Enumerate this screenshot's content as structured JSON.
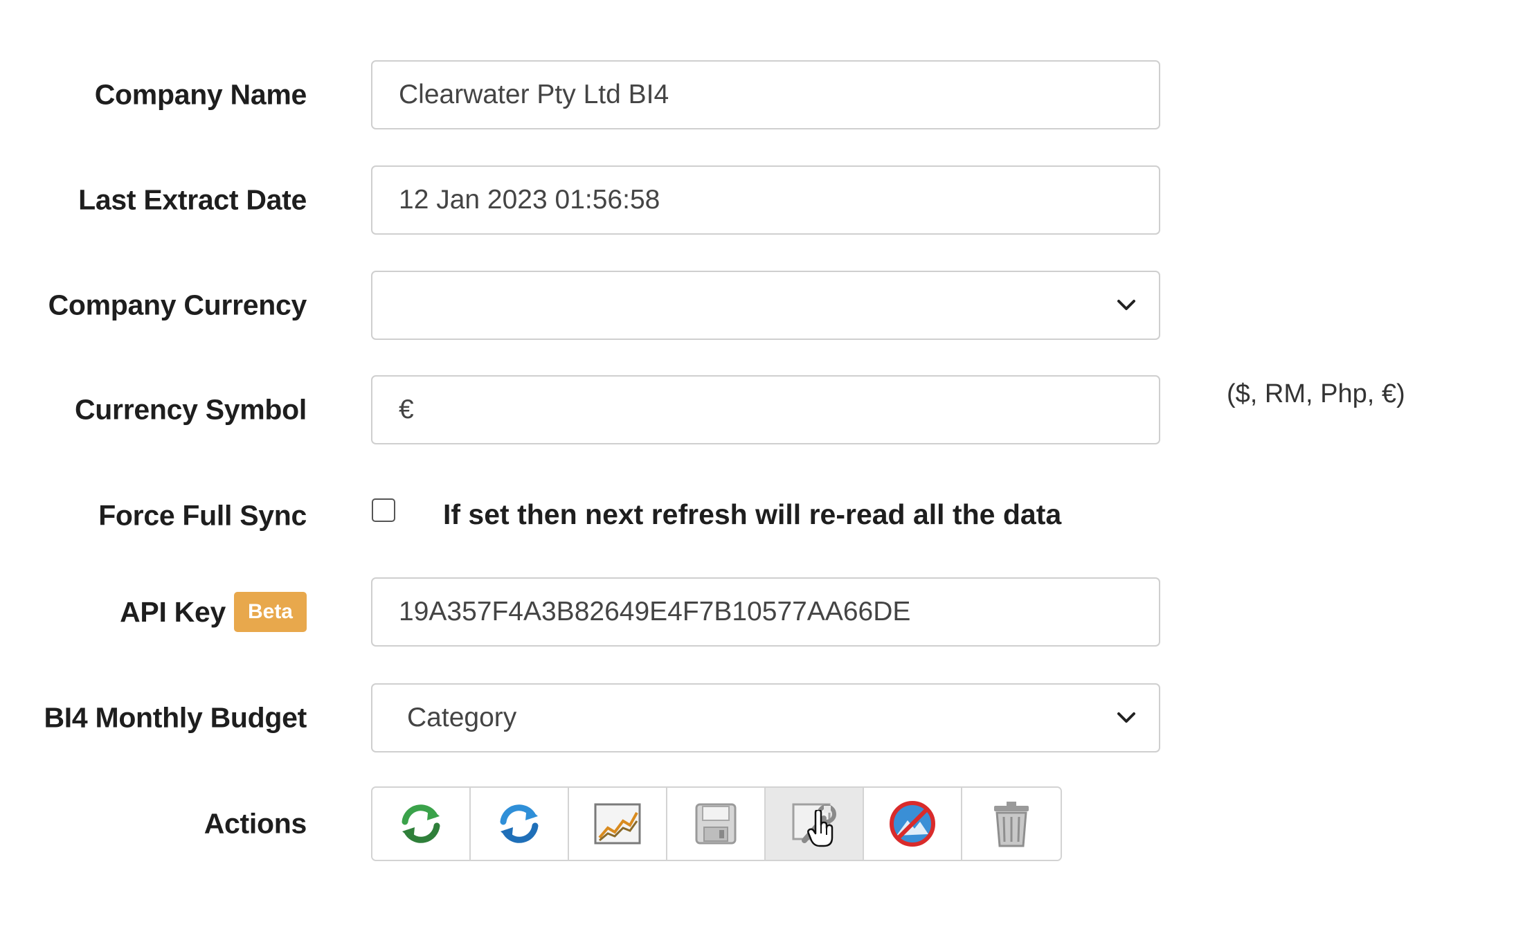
{
  "form": {
    "company_name": {
      "label": "Company Name",
      "value": "Clearwater Pty Ltd BI4"
    },
    "last_extract_date": {
      "label": "Last Extract Date",
      "value": "12 Jan 2023 01:56:58"
    },
    "company_currency": {
      "label": "Company Currency",
      "value": ""
    },
    "currency_symbol": {
      "label": "Currency Symbol",
      "value": "€",
      "hint": "($, RM, Php, €)"
    },
    "force_full_sync": {
      "label": "Force Full Sync",
      "checked": false,
      "description": "If set then next refresh will re-read all the data"
    },
    "api_key": {
      "label": "API Key",
      "badge": "Beta",
      "value": "19A357F4A3B82649E4F7B10577AA66DE"
    },
    "monthly_budget": {
      "label": "BI4 Monthly Budget",
      "value": "Category"
    },
    "actions": {
      "label": "Actions",
      "buttons": [
        {
          "icon": "refresh-green-icon"
        },
        {
          "icon": "sync-blue-icon"
        },
        {
          "icon": "chart-icon"
        },
        {
          "icon": "save-disk-icon"
        },
        {
          "icon": "settings-wrench-icon"
        },
        {
          "icon": "disable-icon"
        },
        {
          "icon": "trash-icon"
        }
      ]
    }
  },
  "colors": {
    "beta_badge": "#e8a84c",
    "border": "#cfcfcf",
    "active_button_bg": "#e8e8e8"
  }
}
